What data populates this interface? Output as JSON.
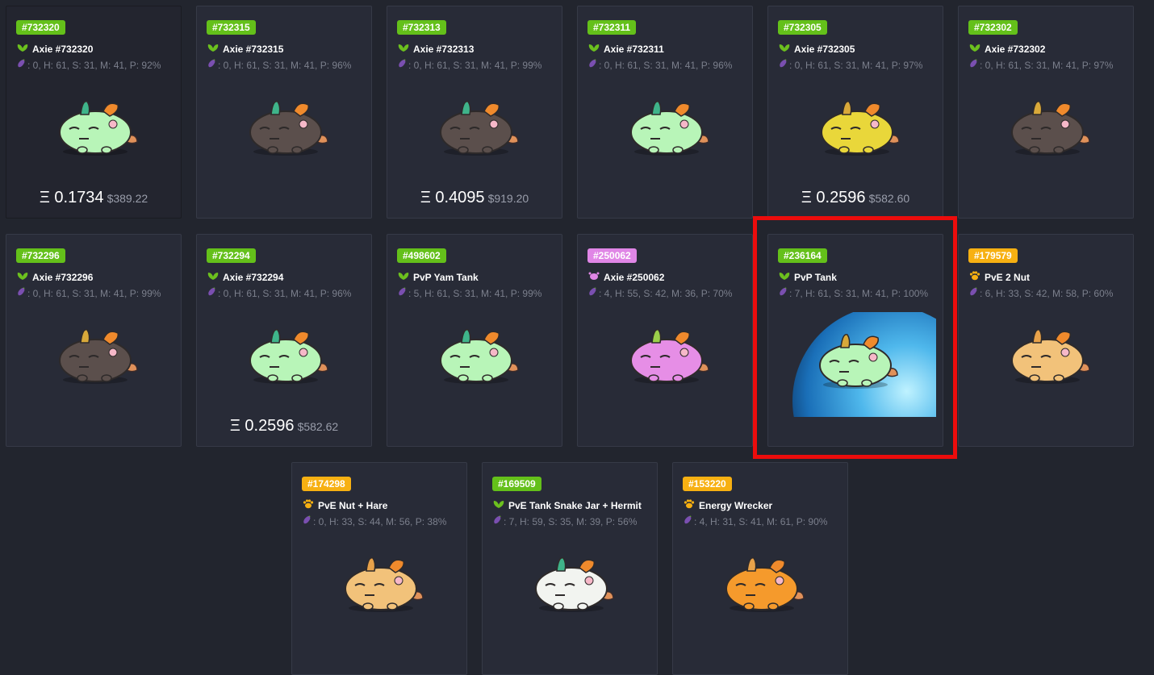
{
  "colors": {
    "green_badge": "#64c01a",
    "pink_badge": "#e086e6",
    "orange_badge": "#f7b012",
    "highlight": "#ec0c0c"
  },
  "cards": [
    {
      "id": "#732320",
      "title": "Axie #732320",
      "stats": ": 0, H: 61, S: 31, M: 41, P: 92%",
      "badge": "green",
      "class_icon": "plant-icon",
      "body": "#b8f5b8",
      "horn": "green",
      "eth": "Ξ 0.1734",
      "usd": "$389.22"
    },
    {
      "id": "#732315",
      "title": "Axie #732315",
      "stats": ": 0, H: 61, S: 31, M: 41, P: 96%",
      "badge": "green",
      "class_icon": "plant-icon",
      "body": "#5b4f4c",
      "horn": "green",
      "eth": "",
      "usd": ""
    },
    {
      "id": "#732313",
      "title": "Axie #732313",
      "stats": ": 0, H: 61, S: 31, M: 41, P: 99%",
      "badge": "green",
      "class_icon": "plant-icon",
      "body": "#5b4f4c",
      "horn": "green",
      "eth": "Ξ 0.4095",
      "usd": "$919.20"
    },
    {
      "id": "#732311",
      "title": "Axie #732311",
      "stats": ": 0, H: 61, S: 31, M: 41, P: 96%",
      "badge": "green",
      "class_icon": "plant-icon",
      "body": "#b8f5b8",
      "horn": "green",
      "eth": "",
      "usd": ""
    },
    {
      "id": "#732305",
      "title": "Axie #732305",
      "stats": ": 0, H: 61, S: 31, M: 41, P: 97%",
      "badge": "green",
      "class_icon": "plant-icon",
      "body": "#e9d73a",
      "horn": "yellow",
      "eth": "Ξ 0.2596",
      "usd": "$582.60"
    },
    {
      "id": "#732302",
      "title": "Axie #732302",
      "stats": ": 0, H: 61, S: 31, M: 41, P: 97%",
      "badge": "green",
      "class_icon": "plant-icon",
      "body": "#5b4f4c",
      "horn": "yellow",
      "eth": "",
      "usd": ""
    },
    {
      "id": "#732296",
      "title": "Axie #732296",
      "stats": ": 0, H: 61, S: 31, M: 41, P: 99%",
      "badge": "green",
      "class_icon": "plant-icon",
      "body": "#5b4f4c",
      "horn": "yellow",
      "eth": "",
      "usd": ""
    },
    {
      "id": "#732294",
      "title": "Axie #732294",
      "stats": ": 0, H: 61, S: 31, M: 41, P: 96%",
      "badge": "green",
      "class_icon": "plant-icon",
      "body": "#b8f5b8",
      "horn": "green",
      "eth": "Ξ 0.2596",
      "usd": "$582.62"
    },
    {
      "id": "#498602",
      "title": "PvP Yam Tank",
      "stats": ": 5, H: 61, S: 31, M: 41, P: 99%",
      "badge": "green",
      "class_icon": "plant-icon",
      "body": "#b8f5b8",
      "horn": "green",
      "eth": "",
      "usd": ""
    },
    {
      "id": "#250062",
      "title": "Axie #250062",
      "stats": ": 4, H: 55, S: 42, M: 36, P: 70%",
      "badge": "pink",
      "class_icon": "bug-icon",
      "body": "#e68ee6",
      "horn": "pink",
      "eth": "",
      "usd": ""
    },
    {
      "id": "#236164",
      "title": "PvP Tank",
      "stats": ": 7, H: 61, S: 31, M: 41, P: 100%",
      "badge": "green",
      "class_icon": "plant-icon",
      "body": "#b8f5b8",
      "horn": "yellow",
      "eth": "",
      "usd": "",
      "orb": true
    },
    {
      "id": "#179579",
      "title": "PvE 2 Nut",
      "stats": ": 6, H: 33, S: 42, M: 58, P: 60%",
      "badge": "orange",
      "class_icon": "paw-icon",
      "body": "#f2c27a",
      "horn": "orange",
      "eth": "",
      "usd": ""
    },
    {
      "id": "#174298",
      "title": "PvE Nut + Hare",
      "stats": ": 0, H: 33, S: 44, M: 56, P: 38%",
      "badge": "orange",
      "class_icon": "paw-icon",
      "body": "#f2c27a",
      "horn": "orange",
      "eth": "",
      "usd": ""
    },
    {
      "id": "#169509",
      "title": "PvE Tank Snake Jar + Hermit",
      "stats": ": 7, H: 59, S: 35, M: 39, P: 56%",
      "badge": "green",
      "class_icon": "plant-icon",
      "body": "#f2f4f0",
      "horn": "green",
      "eth": "",
      "usd": ""
    },
    {
      "id": "#153220",
      "title": "Energy Wrecker",
      "stats": ": 4, H: 31, S: 41, M: 61, P: 90%",
      "badge": "orange",
      "class_icon": "paw-icon",
      "body": "#f59a2c",
      "horn": "orange",
      "eth": "",
      "usd": ""
    }
  ]
}
